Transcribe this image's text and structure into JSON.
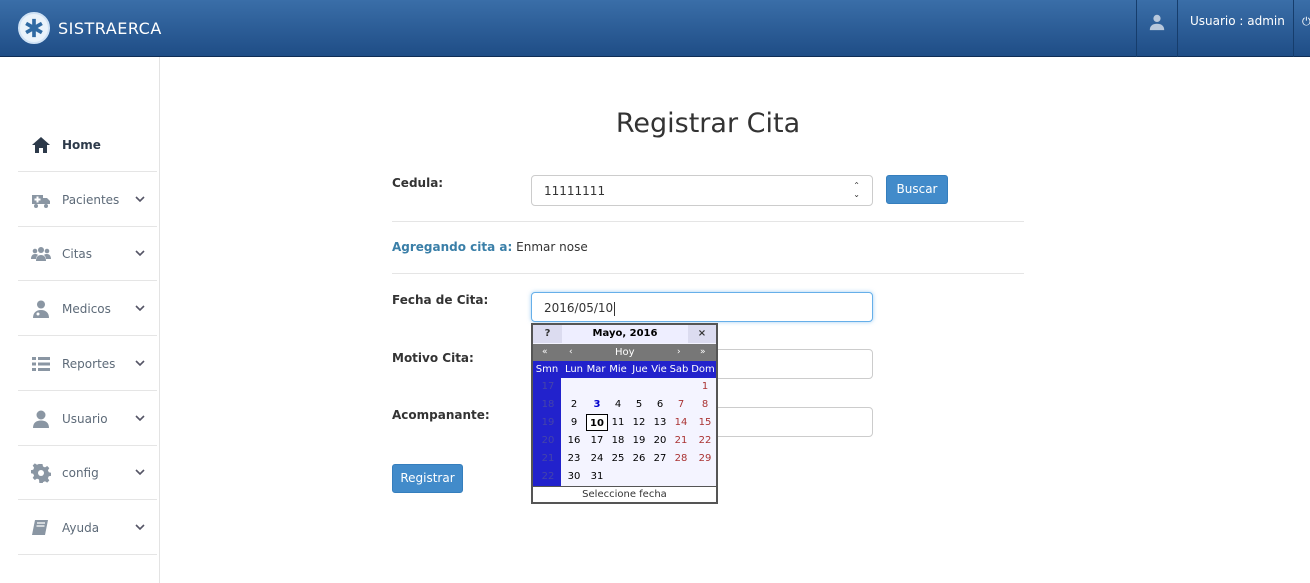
{
  "app": {
    "brand": "SISTRAERCA"
  },
  "topbar": {
    "user_label": "Usuario : admin"
  },
  "sidebar": {
    "items": [
      {
        "label": "Home",
        "icon": "home-icon"
      },
      {
        "label": "Pacientes",
        "icon": "ambulance-icon"
      },
      {
        "label": "Citas",
        "icon": "users-icon"
      },
      {
        "label": "Medicos",
        "icon": "user-md-icon"
      },
      {
        "label": "Reportes",
        "icon": "list-icon"
      },
      {
        "label": "Usuario",
        "icon": "user-icon"
      },
      {
        "label": "config",
        "icon": "gear-icon"
      },
      {
        "label": "Ayuda",
        "icon": "book-icon"
      }
    ]
  },
  "page": {
    "title": "Registrar Cita"
  },
  "form": {
    "cedula_label": "Cedula:",
    "cedula_value": "11111111",
    "buscar_label": "Buscar",
    "adding_key": "Agregando cita a:",
    "adding_value": "Enmar nose",
    "fecha_label": "Fecha de Cita:",
    "fecha_value": "2016/05/10",
    "motivo_label": "Motivo Cita:",
    "acompanante_label": "Acompanante:",
    "registrar_label": "Registrar"
  },
  "calendar": {
    "help": "?",
    "title": "Mayo, 2016",
    "close": "×",
    "nav_prev_year": "«",
    "nav_prev_month": "‹",
    "nav_today": "Hoy",
    "nav_next_month": "›",
    "nav_next_year": "»",
    "day_headers": [
      "Smn",
      "Lun",
      "Mar",
      "Mie",
      "Jue",
      "Vie",
      "Sab",
      "Dom"
    ],
    "weeks": [
      {
        "wk": "17",
        "days": [
          "",
          "",
          "",
          "",
          "",
          "",
          "1"
        ]
      },
      {
        "wk": "18",
        "days": [
          "2",
          "3",
          "4",
          "5",
          "6",
          "7",
          "8"
        ]
      },
      {
        "wk": "19",
        "days": [
          "9",
          "10",
          "11",
          "12",
          "13",
          "14",
          "15"
        ]
      },
      {
        "wk": "20",
        "days": [
          "16",
          "17",
          "18",
          "19",
          "20",
          "21",
          "22"
        ]
      },
      {
        "wk": "21",
        "days": [
          "23",
          "24",
          "25",
          "26",
          "27",
          "28",
          "29"
        ]
      },
      {
        "wk": "22",
        "days": [
          "30",
          "31",
          "",
          "",
          "",
          "",
          ""
        ]
      }
    ],
    "today": "3",
    "selected": "10",
    "footer": "Seleccione fecha"
  }
}
